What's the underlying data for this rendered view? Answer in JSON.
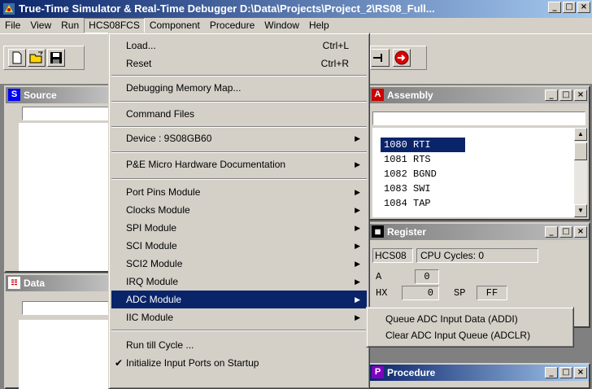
{
  "window": {
    "title": "True-Time Simulator & Real-Time Debugger  D:\\Data\\Projects\\Project_2\\RS08_Full...",
    "minimize": "_",
    "maximize": "□",
    "close": "×"
  },
  "menubar": {
    "items": [
      "File",
      "View",
      "Run",
      "HCS08FCS",
      "Component",
      "Procedure",
      "Window",
      "Help"
    ]
  },
  "panels": {
    "source": {
      "title": "Source",
      "icon": "S"
    },
    "data": {
      "title": "Data"
    },
    "assembly": {
      "title": "Assembly",
      "icon": "A",
      "lines": [
        "1080 RTI",
        "1081 RTS",
        "1082 BGND",
        "1083 SWI",
        "1084 TAP"
      ]
    },
    "register": {
      "title": "Register",
      "cpu": "HCS08",
      "cycles_label": "CPU Cycles: 0",
      "a_label": "A",
      "a_value": "0",
      "hx_label": "HX",
      "hx_value": "0",
      "sp_label": "SP",
      "sp_value": "FF"
    },
    "procedure": {
      "title": "Procedure",
      "icon": "P"
    }
  },
  "hcs08_menu": {
    "load": "Load...",
    "load_shortcut": "Ctrl+L",
    "reset": "Reset",
    "reset_shortcut": "Ctrl+R",
    "memory_map": "Debugging Memory Map...",
    "command_files": "Command Files",
    "device": "Device : 9S08GB60",
    "pe_docs": "P&E Micro Hardware Documentation",
    "port_pins": "Port Pins Module",
    "clocks": "Clocks Module",
    "spi": "SPI Module",
    "sci": "SCI Module",
    "sci2": "SCI2 Module",
    "irq": "IRQ Module",
    "adc": "ADC Module",
    "iic": "IIC Module",
    "run_till": "Run till Cycle ...",
    "init_ports": "Initialize Input Ports on Startup"
  },
  "adc_submenu": {
    "queue": "Queue ADC Input Data (ADDI)",
    "clear": "Clear ADC Input Queue (ADCLR)"
  },
  "colors": {
    "highlight": "#0a246a",
    "face": "#d4d0c8"
  }
}
